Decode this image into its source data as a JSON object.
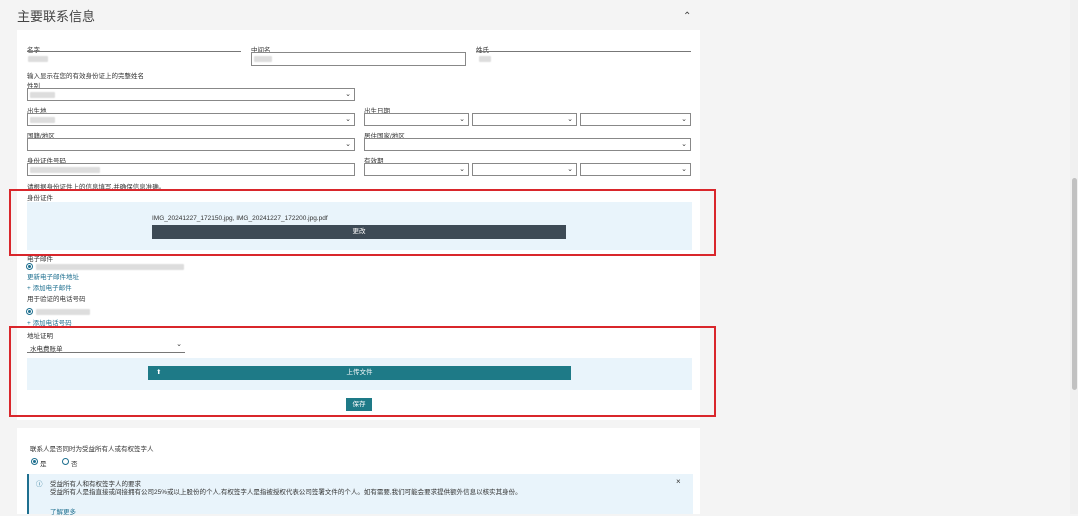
{
  "section": {
    "title": "主要联系信息",
    "collapse_icon": "chevron-up-icon"
  },
  "fields": {
    "given_name": "名字",
    "middle_name": "中间名",
    "surname": "姓氏",
    "name_hint": "输入显示在您的有效身份证上的完整姓名",
    "gender": "性别",
    "birthplace": "出生地",
    "birthdate": "出生日期",
    "nationality": "国籍/地区",
    "residence": "居住国家/地区",
    "id_number": "身份证件号码",
    "expiry": "有效期",
    "id_note": "请根据身份证件上的信息填写,并确保信息准确。",
    "upload_label": "身份证件"
  },
  "upload1": {
    "filename": "IMG_20241227_172150.jpg, IMG_20241227_172200.jpg.pdf",
    "button": "更改"
  },
  "contact": {
    "email_label": "电子邮件",
    "email_link": "更新电子邮件地址",
    "add_email": "+ 添加电子邮件",
    "phone_label": "用于验证的电话号码",
    "add_phone": "+ 添加电话号码"
  },
  "address": {
    "proof_label": "地址证明",
    "select_value": "水电费账单",
    "upload_button": "上传文件",
    "save_button": "保存"
  },
  "beneficiary": {
    "question": "联系人是否同时为受益所有人或有权签字人",
    "yes": "是",
    "no": "否",
    "info_title": "受益所有人和有权签字人的要求",
    "info_text": "受益所有人是指直接或间接拥有公司25%或以上股份的个人,有权签字人是指被授权代表公司签署文件的个人。如有需要,我们可能会要求提供额外信息以核实其身份。",
    "info_more": "了解更多"
  }
}
